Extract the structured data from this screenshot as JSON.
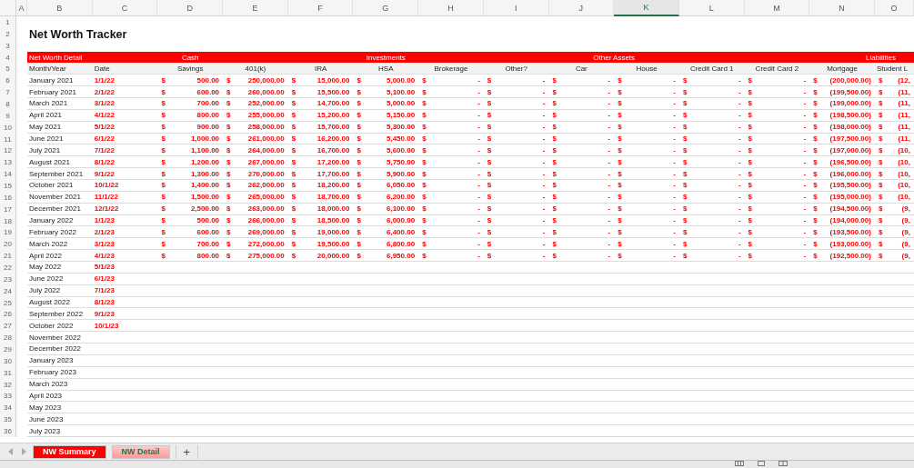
{
  "column_letters": [
    {
      "label": "A",
      "selected": false
    },
    {
      "label": "B",
      "selected": false
    },
    {
      "label": "C",
      "selected": false
    },
    {
      "label": "D",
      "selected": false
    },
    {
      "label": "E",
      "selected": false
    },
    {
      "label": "F",
      "selected": false
    },
    {
      "label": "G",
      "selected": false
    },
    {
      "label": "H",
      "selected": false
    },
    {
      "label": "I",
      "selected": false
    },
    {
      "label": "J",
      "selected": false
    },
    {
      "label": "K",
      "selected": true
    },
    {
      "label": "L",
      "selected": false
    },
    {
      "label": "M",
      "selected": false
    },
    {
      "label": "N",
      "selected": false
    },
    {
      "label": "O",
      "selected": false
    }
  ],
  "title": "Net Worth Tracker",
  "row_numbers": [
    "1",
    "2",
    "3",
    "4",
    "5",
    "6",
    "7",
    "8",
    "9",
    "10",
    "11",
    "12",
    "13",
    "14",
    "15",
    "16",
    "17",
    "18",
    "19",
    "20",
    "21",
    "22",
    "23",
    "24",
    "25",
    "26",
    "27",
    "28",
    "29",
    "30",
    "31",
    "32",
    "33",
    "34",
    "35",
    "36"
  ],
  "groups": [
    "Net Worth Detail",
    "Cash",
    "Investments",
    "Other Assets",
    "Liabilities"
  ],
  "columns": [
    "Month/Year",
    "Date",
    "Savings",
    "401(k)",
    "IRA",
    "HSA",
    "Brokerage",
    "Other?",
    "Car",
    "House",
    "Credit Card 1",
    "Credit Card 2",
    "Mortgage",
    "Student L"
  ],
  "rows": [
    {
      "month": "January 2021",
      "date": "1/1/22",
      "cells": [
        [
          "$",
          "500.00"
        ],
        [
          "$",
          "250,000.00"
        ],
        [
          "$",
          "15,000.00"
        ],
        [
          "$",
          "5,000.00"
        ],
        [
          "$",
          "-"
        ],
        [
          "$",
          "-"
        ],
        [
          "$",
          "-"
        ],
        [
          "$",
          "-"
        ],
        [
          "$",
          "-"
        ],
        [
          "$",
          "-"
        ],
        [
          "$",
          "(200,000.00)"
        ],
        [
          "$",
          "(12,"
        ]
      ]
    },
    {
      "month": "February 2021",
      "date": "2/1/22",
      "cells": [
        [
          "$",
          "600.00"
        ],
        [
          "$",
          "260,000.00"
        ],
        [
          "$",
          "15,500.00"
        ],
        [
          "$",
          "5,100.00"
        ],
        [
          "$",
          "-"
        ],
        [
          "$",
          "-"
        ],
        [
          "$",
          "-"
        ],
        [
          "$",
          "-"
        ],
        [
          "$",
          "-"
        ],
        [
          "$",
          "-"
        ],
        [
          "$",
          "(199,500.00)"
        ],
        [
          "$",
          "(11,"
        ]
      ]
    },
    {
      "month": "March 2021",
      "date": "3/1/22",
      "cells": [
        [
          "$",
          "700.00"
        ],
        [
          "$",
          "252,000.00"
        ],
        [
          "$",
          "14,700.00"
        ],
        [
          "$",
          "5,000.00"
        ],
        [
          "$",
          "-"
        ],
        [
          "$",
          "-"
        ],
        [
          "$",
          "-"
        ],
        [
          "$",
          "-"
        ],
        [
          "$",
          "-"
        ],
        [
          "$",
          "-"
        ],
        [
          "$",
          "(199,000.00)"
        ],
        [
          "$",
          "(11,"
        ]
      ]
    },
    {
      "month": "April 2021",
      "date": "4/1/22",
      "cells": [
        [
          "$",
          "800.00"
        ],
        [
          "$",
          "255,000.00"
        ],
        [
          "$",
          "15,200.00"
        ],
        [
          "$",
          "5,150.00"
        ],
        [
          "$",
          "-"
        ],
        [
          "$",
          "-"
        ],
        [
          "$",
          "-"
        ],
        [
          "$",
          "-"
        ],
        [
          "$",
          "-"
        ],
        [
          "$",
          "-"
        ],
        [
          "$",
          "(198,500.00)"
        ],
        [
          "$",
          "(11,"
        ]
      ]
    },
    {
      "month": "May 2021",
      "date": "5/1/22",
      "cells": [
        [
          "$",
          "900.00"
        ],
        [
          "$",
          "258,000.00"
        ],
        [
          "$",
          "15,700.00"
        ],
        [
          "$",
          "5,300.00"
        ],
        [
          "$",
          "-"
        ],
        [
          "$",
          "-"
        ],
        [
          "$",
          "-"
        ],
        [
          "$",
          "-"
        ],
        [
          "$",
          "-"
        ],
        [
          "$",
          "-"
        ],
        [
          "$",
          "(198,000.00)"
        ],
        [
          "$",
          "(11,"
        ]
      ]
    },
    {
      "month": "June 2021",
      "date": "6/1/22",
      "cells": [
        [
          "$",
          "1,000.00"
        ],
        [
          "$",
          "261,000.00"
        ],
        [
          "$",
          "16,200.00"
        ],
        [
          "$",
          "5,450.00"
        ],
        [
          "$",
          "-"
        ],
        [
          "$",
          "-"
        ],
        [
          "$",
          "-"
        ],
        [
          "$",
          "-"
        ],
        [
          "$",
          "-"
        ],
        [
          "$",
          "-"
        ],
        [
          "$",
          "(197,500.00)"
        ],
        [
          "$",
          "(11,"
        ]
      ]
    },
    {
      "month": "July 2021",
      "date": "7/1/22",
      "cells": [
        [
          "$",
          "1,100.00"
        ],
        [
          "$",
          "264,000.00"
        ],
        [
          "$",
          "16,700.00"
        ],
        [
          "$",
          "5,600.00"
        ],
        [
          "$",
          "-"
        ],
        [
          "$",
          "-"
        ],
        [
          "$",
          "-"
        ],
        [
          "$",
          "-"
        ],
        [
          "$",
          "-"
        ],
        [
          "$",
          "-"
        ],
        [
          "$",
          "(197,000.00)"
        ],
        [
          "$",
          "(10,"
        ]
      ]
    },
    {
      "month": "August 2021",
      "date": "8/1/22",
      "cells": [
        [
          "$",
          "1,200.00"
        ],
        [
          "$",
          "267,000.00"
        ],
        [
          "$",
          "17,200.00"
        ],
        [
          "$",
          "5,750.00"
        ],
        [
          "$",
          "-"
        ],
        [
          "$",
          "-"
        ],
        [
          "$",
          "-"
        ],
        [
          "$",
          "-"
        ],
        [
          "$",
          "-"
        ],
        [
          "$",
          "-"
        ],
        [
          "$",
          "(196,500.00)"
        ],
        [
          "$",
          "(10,"
        ]
      ]
    },
    {
      "month": "September 2021",
      "date": "9/1/22",
      "cells": [
        [
          "$",
          "1,300.00"
        ],
        [
          "$",
          "270,000.00"
        ],
        [
          "$",
          "17,700.00"
        ],
        [
          "$",
          "5,900.00"
        ],
        [
          "$",
          "-"
        ],
        [
          "$",
          "-"
        ],
        [
          "$",
          "-"
        ],
        [
          "$",
          "-"
        ],
        [
          "$",
          "-"
        ],
        [
          "$",
          "-"
        ],
        [
          "$",
          "(196,000.00)"
        ],
        [
          "$",
          "(10,"
        ]
      ]
    },
    {
      "month": "October 2021",
      "date": "10/1/22",
      "cells": [
        [
          "$",
          "1,400.00"
        ],
        [
          "$",
          "262,000.00"
        ],
        [
          "$",
          "18,200.00"
        ],
        [
          "$",
          "6,050.00"
        ],
        [
          "$",
          "-"
        ],
        [
          "$",
          "-"
        ],
        [
          "$",
          "-"
        ],
        [
          "$",
          "-"
        ],
        [
          "$",
          "-"
        ],
        [
          "$",
          "-"
        ],
        [
          "$",
          "(195,500.00)"
        ],
        [
          "$",
          "(10,"
        ]
      ]
    },
    {
      "month": "November 2021",
      "date": "11/1/22",
      "cells": [
        [
          "$",
          "1,500.00"
        ],
        [
          "$",
          "265,000.00"
        ],
        [
          "$",
          "18,700.00"
        ],
        [
          "$",
          "6,200.00"
        ],
        [
          "$",
          "-"
        ],
        [
          "$",
          "-"
        ],
        [
          "$",
          "-"
        ],
        [
          "$",
          "-"
        ],
        [
          "$",
          "-"
        ],
        [
          "$",
          "-"
        ],
        [
          "$",
          "(195,000.00)"
        ],
        [
          "$",
          "(10,"
        ]
      ]
    },
    {
      "month": "December 2021",
      "date": "12/1/22",
      "cells": [
        [
          "$",
          "2,500.00"
        ],
        [
          "$",
          "263,000.00"
        ],
        [
          "$",
          "18,000.00"
        ],
        [
          "$",
          "6,100.00"
        ],
        [
          "$",
          "-"
        ],
        [
          "$",
          "-"
        ],
        [
          "$",
          "-"
        ],
        [
          "$",
          "-"
        ],
        [
          "$",
          "-"
        ],
        [
          "$",
          "-"
        ],
        [
          "$",
          "(194,500.00)"
        ],
        [
          "$",
          "(9,"
        ]
      ]
    },
    {
      "month": "January 2022",
      "date": "1/1/23",
      "cells": [
        [
          "$",
          "500.00"
        ],
        [
          "$",
          "266,000.00"
        ],
        [
          "$",
          "18,500.00"
        ],
        [
          "$",
          "6,000.00"
        ],
        [
          "$",
          "-"
        ],
        [
          "$",
          "-"
        ],
        [
          "$",
          "-"
        ],
        [
          "$",
          "-"
        ],
        [
          "$",
          "-"
        ],
        [
          "$",
          "-"
        ],
        [
          "$",
          "(194,000.00)"
        ],
        [
          "$",
          "(9,"
        ]
      ]
    },
    {
      "month": "February 2022",
      "date": "2/1/23",
      "cells": [
        [
          "$",
          "600.00"
        ],
        [
          "$",
          "269,000.00"
        ],
        [
          "$",
          "19,000.00"
        ],
        [
          "$",
          "6,400.00"
        ],
        [
          "$",
          "-"
        ],
        [
          "$",
          "-"
        ],
        [
          "$",
          "-"
        ],
        [
          "$",
          "-"
        ],
        [
          "$",
          "-"
        ],
        [
          "$",
          "-"
        ],
        [
          "$",
          "(193,500.00)"
        ],
        [
          "$",
          "(9,"
        ]
      ]
    },
    {
      "month": "March 2022",
      "date": "3/1/23",
      "cells": [
        [
          "$",
          "700.00"
        ],
        [
          "$",
          "272,000.00"
        ],
        [
          "$",
          "19,500.00"
        ],
        [
          "$",
          "6,800.00"
        ],
        [
          "$",
          "-"
        ],
        [
          "$",
          "-"
        ],
        [
          "$",
          "-"
        ],
        [
          "$",
          "-"
        ],
        [
          "$",
          "-"
        ],
        [
          "$",
          "-"
        ],
        [
          "$",
          "(193,000.00)"
        ],
        [
          "$",
          "(9,"
        ]
      ]
    },
    {
      "month": "April 2022",
      "date": "4/1/23",
      "cells": [
        [
          "$",
          "800.00"
        ],
        [
          "$",
          "275,000.00"
        ],
        [
          "$",
          "20,000.00"
        ],
        [
          "$",
          "6,950.00"
        ],
        [
          "$",
          "-"
        ],
        [
          "$",
          "-"
        ],
        [
          "$",
          "-"
        ],
        [
          "$",
          "-"
        ],
        [
          "$",
          "-"
        ],
        [
          "$",
          "-"
        ],
        [
          "$",
          "(192,500.00)"
        ],
        [
          "$",
          "(9,"
        ]
      ]
    },
    {
      "month": "May 2022",
      "date": "5/1/23"
    },
    {
      "month": "June 2022",
      "date": "6/1/23"
    },
    {
      "month": "July 2022",
      "date": "7/1/23"
    },
    {
      "month": "August 2022",
      "date": "8/1/23"
    },
    {
      "month": "September 2022",
      "date": "9/1/23"
    },
    {
      "month": "October 2022",
      "date": "10/1/23"
    },
    {
      "month": "November 2022"
    },
    {
      "month": "December 2022"
    },
    {
      "month": "January 2023"
    },
    {
      "month": "February 2023"
    },
    {
      "month": "March 2023"
    },
    {
      "month": "April 2023"
    },
    {
      "month": "May 2023"
    },
    {
      "month": "June 2023"
    },
    {
      "month": "July 2023"
    }
  ],
  "sheet_tabs": [
    {
      "label": "NW Summary",
      "selected": false
    },
    {
      "label": "NW Detail",
      "selected": true
    }
  ],
  "add_sheet": "+"
}
